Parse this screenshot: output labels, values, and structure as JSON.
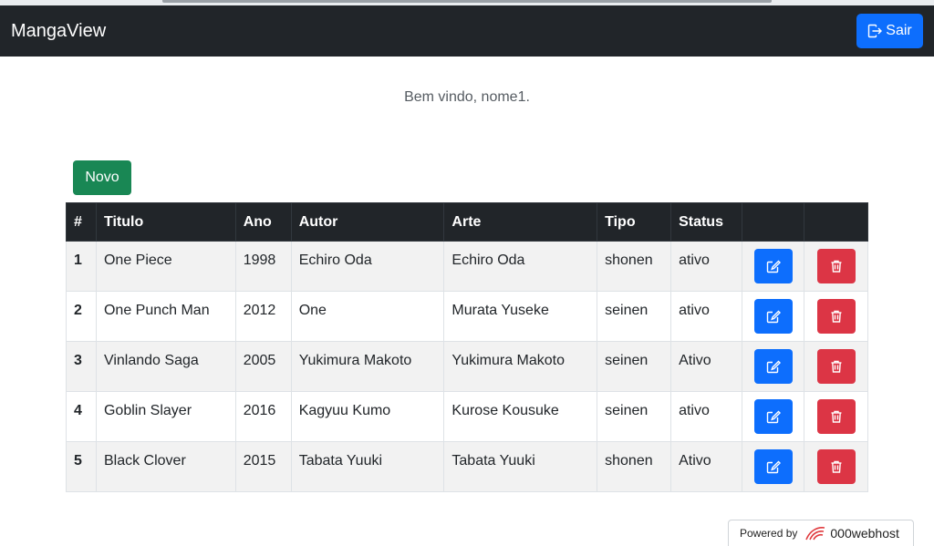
{
  "navbar": {
    "brand": "MangaView",
    "logout_label": "Sair"
  },
  "welcome": "Bem vindo, nome1.",
  "new_button": "Novo",
  "table": {
    "headers": [
      "#",
      "Titulo",
      "Ano",
      "Autor",
      "Arte",
      "Tipo",
      "Status",
      "",
      ""
    ],
    "rows": [
      {
        "id": "1",
        "titulo": "One Piece",
        "ano": "1998",
        "autor": "Echiro Oda",
        "arte": "Echiro Oda",
        "tipo": "shonen",
        "status": "ativo"
      },
      {
        "id": "2",
        "titulo": "One Punch Man",
        "ano": "2012",
        "autor": "One",
        "arte": "Murata Yuseke",
        "tipo": "seinen",
        "status": "ativo"
      },
      {
        "id": "3",
        "titulo": "Vinlando Saga",
        "ano": "2005",
        "autor": "Yukimura Makoto",
        "arte": "Yukimura Makoto",
        "tipo": "seinen",
        "status": "Ativo"
      },
      {
        "id": "4",
        "titulo": "Goblin Slayer",
        "ano": "2016",
        "autor": "Kagyuu Kumo",
        "arte": "Kurose Kousuke",
        "tipo": "seinen",
        "status": "ativo"
      },
      {
        "id": "5",
        "titulo": "Black Clover",
        "ano": "2015",
        "autor": "Tabata Yuuki",
        "arte": "Tabata Yuuki",
        "tipo": "shonen",
        "status": "Ativo"
      }
    ]
  },
  "footer_badge": {
    "powered_by": "Powered by",
    "host": "000webhost"
  },
  "icons": {
    "logout": "box-arrow-right-icon",
    "edit": "pencil-square-icon",
    "delete": "trash-icon",
    "host_logo": "webhost-logo-icon"
  },
  "colors": {
    "navbar": "#212529",
    "primary": "#0d6efd",
    "success": "#198754",
    "danger": "#dc3545"
  }
}
